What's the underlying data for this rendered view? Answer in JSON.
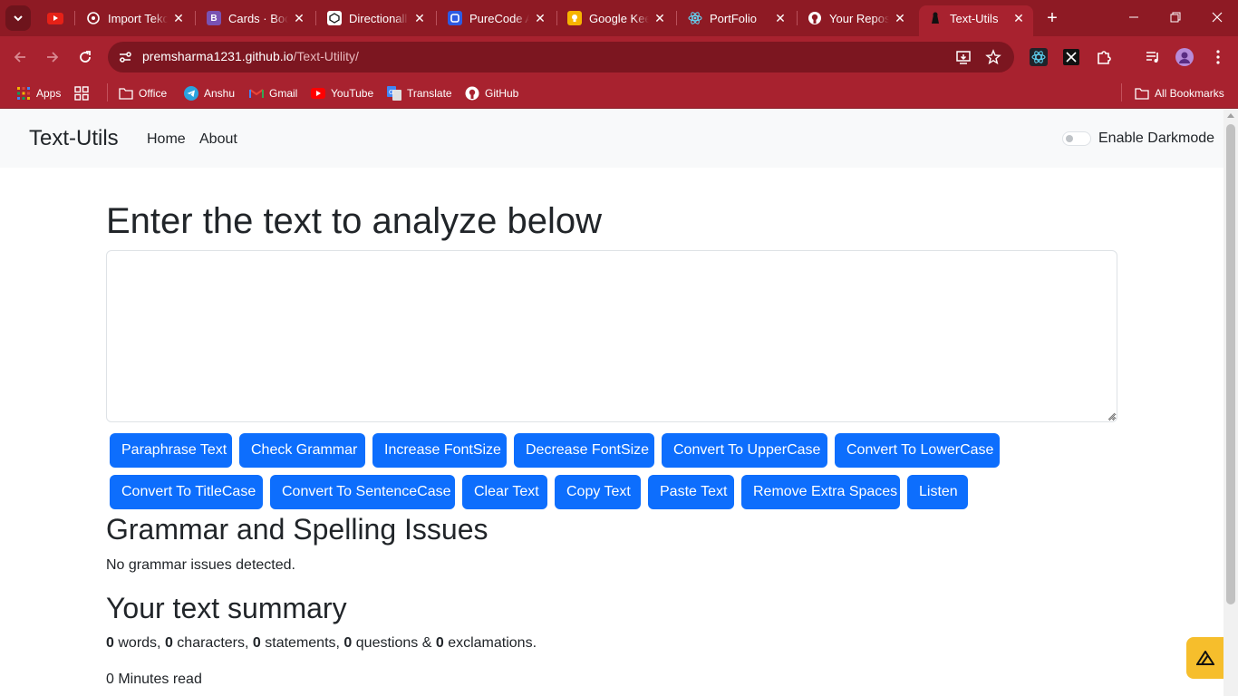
{
  "browser": {
    "tabs": [
      {
        "title": "",
        "color": "#e62117",
        "icon": "youtube-icon"
      },
      {
        "title": "Import Teko",
        "color": "#222222",
        "icon": "openai-icon"
      },
      {
        "title": "Cards · Boot",
        "color": "#7952b3",
        "icon": "bootstrap-icon",
        "glyph": "B"
      },
      {
        "title": "Directionall",
        "color": "#ffffff",
        "icon": "codepen-icon"
      },
      {
        "title": "PureCode A",
        "color": "#2d5be3",
        "icon": "purecode-icon"
      },
      {
        "title": "Google Kee",
        "color": "#f6b400",
        "icon": "keep-icon"
      },
      {
        "title": "PortFolio",
        "color": "#222222",
        "icon": "react-icon"
      },
      {
        "title": "Your Reposi",
        "color": "#ffffff",
        "icon": "github-icon"
      },
      {
        "title": "Text-Utils",
        "color": "#111111",
        "icon": "textutils-icon"
      }
    ],
    "url_host": "premsharma1231.github.io",
    "url_path": "/Text-Utility/",
    "bookmarks": [
      {
        "label": "Apps",
        "icon": "apps-icon"
      },
      {
        "label": "Office",
        "icon": "folder-icon"
      },
      {
        "label": "Anshu",
        "icon": "telegram-icon"
      },
      {
        "label": "Gmail",
        "icon": "gmail-icon"
      },
      {
        "label": "YouTube",
        "icon": "youtube-icon"
      },
      {
        "label": "Translate",
        "icon": "translate-icon"
      },
      {
        "label": "GitHub",
        "icon": "github-icon"
      }
    ],
    "all_bookmarks": "All Bookmarks"
  },
  "navbar": {
    "brand": "Text-Utils",
    "links": [
      "Home",
      "About"
    ],
    "darkmode_label": "Enable Darkmode",
    "darkmode_enabled": false
  },
  "main": {
    "title": "Enter the text to analyze below",
    "textarea_value": "",
    "buttons_row1": [
      "Paraphrase Text",
      "Check Grammar",
      "Increase FontSize",
      "Decrease FontSize",
      "Convert To UpperCase",
      "Convert To LowerCase"
    ],
    "buttons_row2": [
      "Convert To TitleCase",
      "Convert To SentenceCase",
      "Clear Text",
      "Copy Text",
      "Paste Text",
      "Remove Extra Spaces",
      "Listen"
    ],
    "issues_heading": "Grammar and Spelling Issues",
    "issues_text": "No grammar issues detected.",
    "summary_heading": "Your text summary",
    "summary": {
      "words": "0",
      "words_label": "words,",
      "characters": "0",
      "characters_label": "characters,",
      "statements": "0",
      "statements_label": "statements,",
      "questions": "0",
      "questions_label": "questions &",
      "exclamations": "0",
      "exclamations_label": "exclamations."
    },
    "read_time": "0 Minutes read"
  },
  "colors": {
    "chrome_tabstrip": "#8e1a24",
    "chrome_toolbar": "#a8222f",
    "primary_button": "#0d6efd",
    "navbar_bg": "#f8f9fa",
    "floating_button": "#f6be2c"
  }
}
